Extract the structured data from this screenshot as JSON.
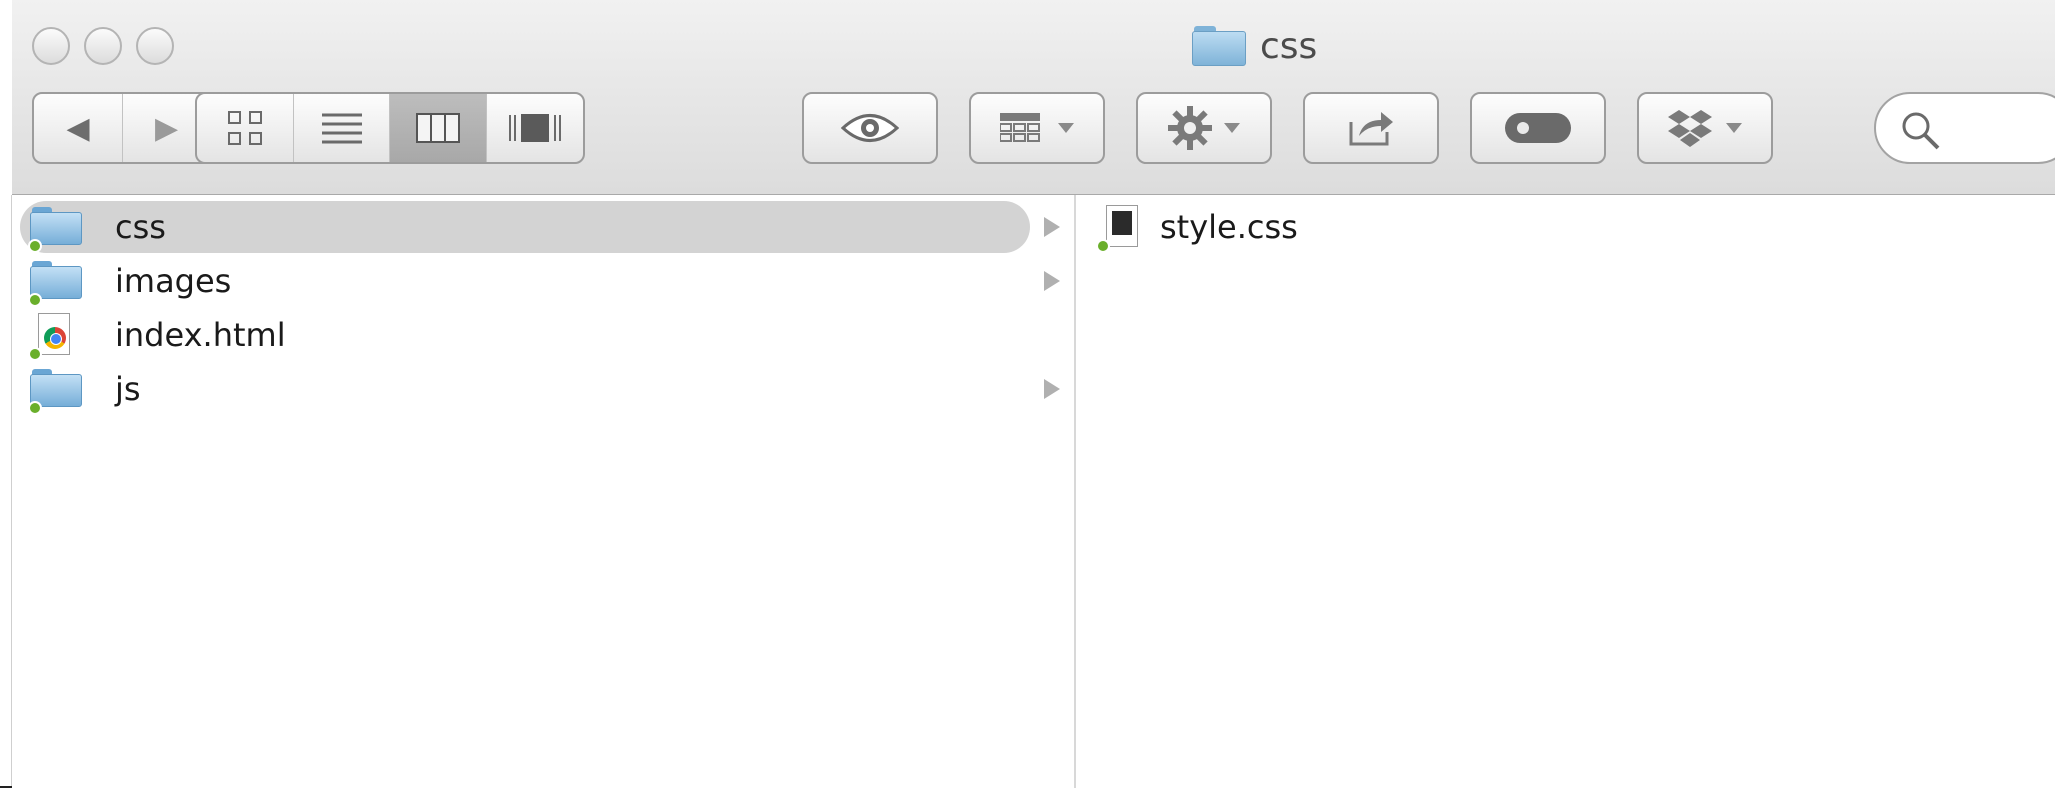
{
  "window": {
    "title": "css"
  },
  "toolbar": {
    "back": "◀",
    "forward": "▶",
    "view_modes": [
      "icon-view",
      "list-view",
      "column-view",
      "cover-flow-view"
    ],
    "active_view": "column-view"
  },
  "sidebar_column": {
    "items": [
      {
        "label": "css",
        "type": "folder",
        "selected": true,
        "has_children": true
      },
      {
        "label": "images",
        "type": "folder",
        "selected": false,
        "has_children": true
      },
      {
        "label": "index.html",
        "type": "html-file",
        "selected": false,
        "has_children": false
      },
      {
        "label": "js",
        "type": "folder",
        "selected": false,
        "has_children": true
      }
    ]
  },
  "detail_column": {
    "items": [
      {
        "label": "style.css",
        "type": "css-file"
      }
    ]
  },
  "colors": {
    "selection": "#d3d3d3",
    "folder_blue": "#76aed8",
    "sync_badge": "#6aaf2b"
  }
}
